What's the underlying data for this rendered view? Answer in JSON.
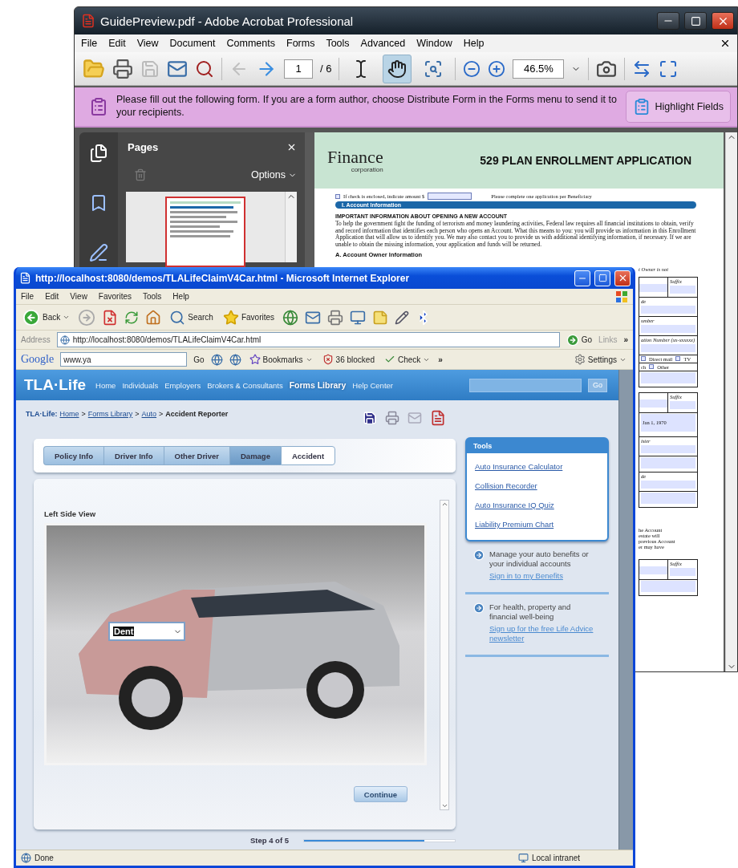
{
  "acrobat": {
    "title": "GuidePreview.pdf - Adobe Acrobat Professional",
    "menu": [
      "File",
      "Edit",
      "View",
      "Document",
      "Comments",
      "Forms",
      "Tools",
      "Advanced",
      "Window",
      "Help"
    ],
    "toolbar": {
      "page": "1",
      "page_count": "/ 6",
      "zoom": "46.5%",
      "tools": [
        {
          "kind": "select",
          "selected": false
        },
        {
          "kind": "hand",
          "selected": true
        },
        {
          "kind": "zoom",
          "selected": false
        }
      ]
    },
    "form_bar": {
      "message": "Please fill out the following form. If you are a form author, choose Distribute Form in the Forms menu to send it to your recipients.",
      "button": "Highlight Fields"
    },
    "pages_panel": {
      "title": "Pages",
      "options": "Options"
    },
    "document": {
      "logo": "Finance",
      "logo_sub": "corporation",
      "title": "529 PLAN ENROLLMENT APPLICATION",
      "check_box": {
        "checked": false
      },
      "check_label": "If check is enclosed, indicate amount $",
      "note": "Please complete one application per Beneficiary",
      "section": "I.  Account Information",
      "heading": "IMPORTANT INFORMATION ABOUT OPENING A NEW ACCOUNT",
      "paragraph": "To help the government fight the funding of terrorism and money laundering activities, Federal law requires all financial institutions to obtain, verify and record information that identifies each person who opens an Account. What this means to you: you will provide us information in this Enrollment Application that will allow us to identify you. We may also contact you to provide us with additional identifying information, if necessary. If we are unable to obtain the missing information, your application and funds will be returned.",
      "subsection": "A.  Account Owner Information",
      "fragments": [
        {
          "kind": "text",
          "text": "t Owner is not"
        },
        {
          "kind": "pair",
          "label": "Suffix"
        },
        {
          "kind": "labeled",
          "label": "de"
        },
        {
          "kind": "labeled",
          "label": "umber"
        },
        {
          "kind": "labeled",
          "label": "ation Number (xx-xxxxxx)"
        },
        {
          "kind": "checks",
          "options": [
            {
              "label": "Direct mail",
              "checked": false
            },
            {
              "label": "TV",
              "checked": false
            }
          ]
        },
        {
          "kind": "checks",
          "lead": "ch",
          "options": [
            {
              "label": "Other",
              "checked": false
            }
          ]
        },
        {
          "kind": "field"
        },
        {
          "kind": "pair",
          "label": "Suffix"
        },
        {
          "kind": "value",
          "value": "Jan 1, 1970"
        },
        {
          "kind": "labeled",
          "label": "ister"
        },
        {
          "kind": "field"
        },
        {
          "kind": "labeled",
          "label": "de"
        },
        {
          "kind": "field"
        },
        {
          "kind": "lines",
          "lines": [
            "he Account",
            "estate will",
            "previous Account",
            "er may have"
          ]
        },
        {
          "kind": "pair",
          "label": "Suffix"
        },
        {
          "kind": "field"
        }
      ]
    }
  },
  "ie": {
    "title": "http://localhost:8080/demos/TLALifeClaimV4Car.html - Microsoft Internet Explorer",
    "menu": [
      "File",
      "Edit",
      "View",
      "Favorites",
      "Tools",
      "Help"
    ],
    "toolbar": {
      "back": "Back",
      "search": "Search",
      "favorites": "Favorites"
    },
    "address": {
      "label": "Address",
      "url": "http://localhost:8080/demos/TLALifeClaimV4Car.html",
      "go": "Go",
      "links": "Links",
      "more": "»"
    },
    "google_bar": {
      "logo": "Google",
      "query": "www.ya",
      "go": "Go",
      "bookmarks": "Bookmarks",
      "blocked": "36 blocked",
      "check": "Check",
      "more": "»",
      "settings": "Settings"
    },
    "page": {
      "logo": "TLA·Life",
      "nav": [
        {
          "label": "Home",
          "selected": false
        },
        {
          "label": "Individuals",
          "selected": false
        },
        {
          "label": "Employers",
          "selected": false
        },
        {
          "label": "Brokers & Consultants",
          "selected": false
        },
        {
          "label": "Forms Library",
          "selected": true
        },
        {
          "label": "Help Center",
          "selected": false
        }
      ],
      "search_button": "Go",
      "breadcrumb": [
        {
          "kind": "brand",
          "text": "TLA·Life:"
        },
        {
          "kind": "link",
          "text": "Home"
        },
        {
          "kind": "sep",
          "text": ">"
        },
        {
          "kind": "link",
          "text": "Forms Library"
        },
        {
          "kind": "sep",
          "text": ">"
        },
        {
          "kind": "link",
          "text": "Auto"
        },
        {
          "kind": "sep",
          "text": ">"
        },
        {
          "kind": "current",
          "text": "Accident Reporter"
        }
      ],
      "tabs": [
        {
          "label": "Policy Info",
          "selected": false,
          "completed": true
        },
        {
          "label": "Driver Info",
          "selected": false,
          "completed": true
        },
        {
          "label": "Other Driver",
          "selected": false,
          "completed": true
        },
        {
          "label": "Damage",
          "selected": true,
          "completed": true
        },
        {
          "label": "Accident",
          "selected": false,
          "completed": false
        }
      ],
      "view": {
        "title": "Left Side View",
        "damage_value": "Dent",
        "continue": "Continue"
      },
      "progress": {
        "label": "Step 4 of 5",
        "level": 0.8
      },
      "tools": {
        "title": "Tools",
        "links": [
          "Auto Insurance Calculator",
          "Collision Recorder",
          "Auto Insurance IQ Quiz",
          "Liability Premium Chart"
        ]
      },
      "promos": [
        {
          "text": "Manage your auto benefits or your individual accounts",
          "link": "Sign in to my Benefits"
        },
        {
          "text": "For health, property and financial well-being",
          "link": "Sign up for the free Life Advice newsletter"
        }
      ]
    },
    "status": {
      "text": "Done",
      "zone": "Local intranet"
    }
  }
}
